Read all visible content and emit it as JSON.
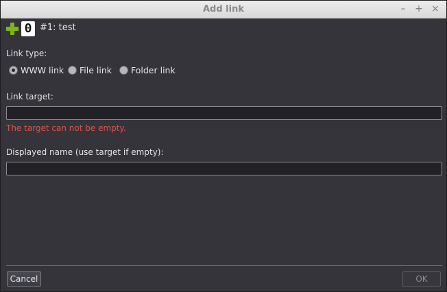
{
  "window": {
    "title": "Add link",
    "controls": {
      "minimize": "–",
      "maximize": "+",
      "close": "×"
    }
  },
  "header": {
    "icon": "plus-icon",
    "count": "0",
    "text": "#1: test"
  },
  "link_type": {
    "label": "Link type:",
    "options": [
      {
        "label": "WWW link",
        "checked": true
      },
      {
        "label": "File link",
        "checked": false
      },
      {
        "label": "Folder link",
        "checked": false
      }
    ]
  },
  "target": {
    "label": "Link target:",
    "value": "",
    "error": "The target can not be empty."
  },
  "display_name": {
    "label": "Displayed name (use target if empty):",
    "value": ""
  },
  "buttons": {
    "cancel": "Cancel",
    "ok": "OK"
  },
  "colors": {
    "accent_plus": "#7cb518",
    "error": "#d9534f"
  }
}
